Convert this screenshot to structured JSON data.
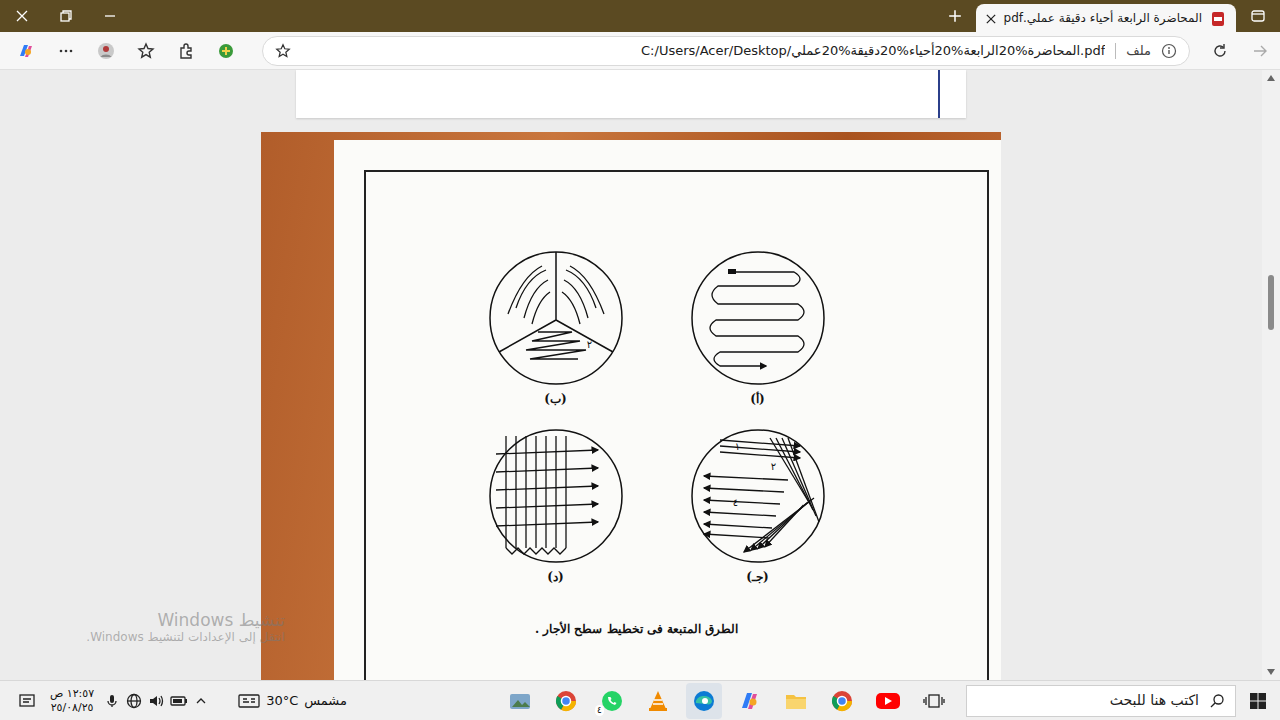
{
  "tabs": [
    {
      "label": "المحاضرة الرابعة أحياء دقيقة عملي.pdf",
      "selected": true
    }
  ],
  "address_bar": {
    "url": "C:/Users/Acer/Desktop/المحاضرة%20الرابعة%20أحياء%20دقيقة%20عملي.pdf",
    "scheme": "ملف"
  },
  "document": {
    "figures": [
      {
        "label": "(أ)",
        "kind": "zigzag",
        "numbers": []
      },
      {
        "label": "(ب)",
        "kind": "sectors",
        "numbers": [
          "٢"
        ]
      },
      {
        "label": "(جـ)",
        "kind": "overlap",
        "numbers": [
          "١",
          "٢",
          "٤"
        ]
      },
      {
        "label": "(د)",
        "kind": "grid",
        "numbers": []
      }
    ],
    "caption": "الطرق المتبعة فى تخطيط سطح الأجار ."
  },
  "watermark": {
    "title": "تنشيط Windows",
    "subtitle": "انتقل إلى الإعدادات لتنشيط Windows."
  },
  "taskbar": {
    "clock": {
      "time": "١٢:٥٧ ص",
      "date": "٢٥/٠٨/٢٥"
    },
    "weather": {
      "temperature": "30°C",
      "condition": "مشمس"
    },
    "whatsapp_badge": "٤",
    "search": {
      "placeholder": "اكتب هنا للبحث"
    }
  }
}
